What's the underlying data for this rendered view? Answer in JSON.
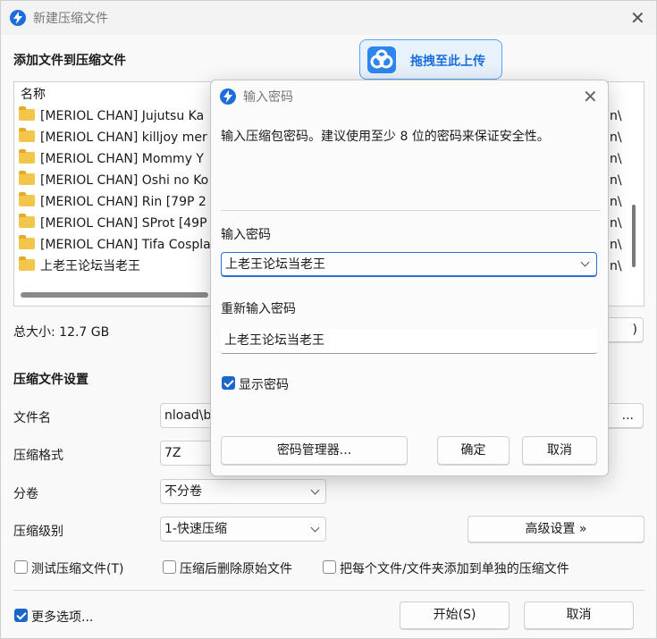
{
  "main": {
    "title": "新建压缩文件",
    "add_files_label": "添加文件到压缩文件",
    "upload_button": "拖拽至此上传",
    "file_list": {
      "header_name": "名称",
      "rows": [
        {
          "name": "[MERIOL CHAN] Jujutsu Ka",
          "suffix": "n\\"
        },
        {
          "name": "[MERIOL CHAN] killjoy mer",
          "suffix": "n\\"
        },
        {
          "name": "[MERIOL CHAN] Mommy Y",
          "suffix": "n\\"
        },
        {
          "name": "[MERIOL CHAN] Oshi no Ko",
          "suffix": "n\\"
        },
        {
          "name": "[MERIOL CHAN] Rin [79P 2",
          "suffix": "n\\"
        },
        {
          "name": "[MERIOL CHAN] SProt [49P",
          "suffix": "n\\"
        },
        {
          "name": "[MERIOL CHAN] Tifa Cospla",
          "suffix": "n\\"
        },
        {
          "name": "上老王论坛当老王",
          "suffix": "n\\"
        }
      ]
    },
    "total_size": "总大小: 12.7 GB",
    "total_size_btn_fragment": ")",
    "settings_title": "压缩文件设置",
    "filename_label": "文件名",
    "filename_value": "nload\\b",
    "browse_button": "...",
    "format_label": "压缩格式",
    "format_value": "7Z",
    "volume_label": "分卷",
    "volume_value": "不分卷",
    "level_label": "压缩级别",
    "level_value": "1-快速压缩",
    "advanced_button": "高级设置 »",
    "test_label": "测试压缩文件(T)",
    "delete_label": "压缩后删除原始文件",
    "separate_label": "把每个文件/文件夹添加到单独的压缩文件",
    "more_label": "更多选项...",
    "start_button": "开始(S)",
    "cancel_button": "取消"
  },
  "dialog": {
    "title": "输入密码",
    "description": "输入压缩包密码。建议使用至少 8 位的密码来保证安全性。",
    "password_label": "输入密码",
    "password_value": "上老王论坛当老王",
    "reenter_label": "重新输入密码",
    "reenter_value": "上老王论坛当老王",
    "show_password_label": "显示密码",
    "manager_button": "密码管理器...",
    "ok_button": "确定",
    "cancel_button": "取消"
  },
  "colors": {
    "accent": "#1a66c9",
    "upload_text": "#1b6fdc",
    "upload_bg": "#e8f2fd",
    "folder": "#f3c649"
  }
}
